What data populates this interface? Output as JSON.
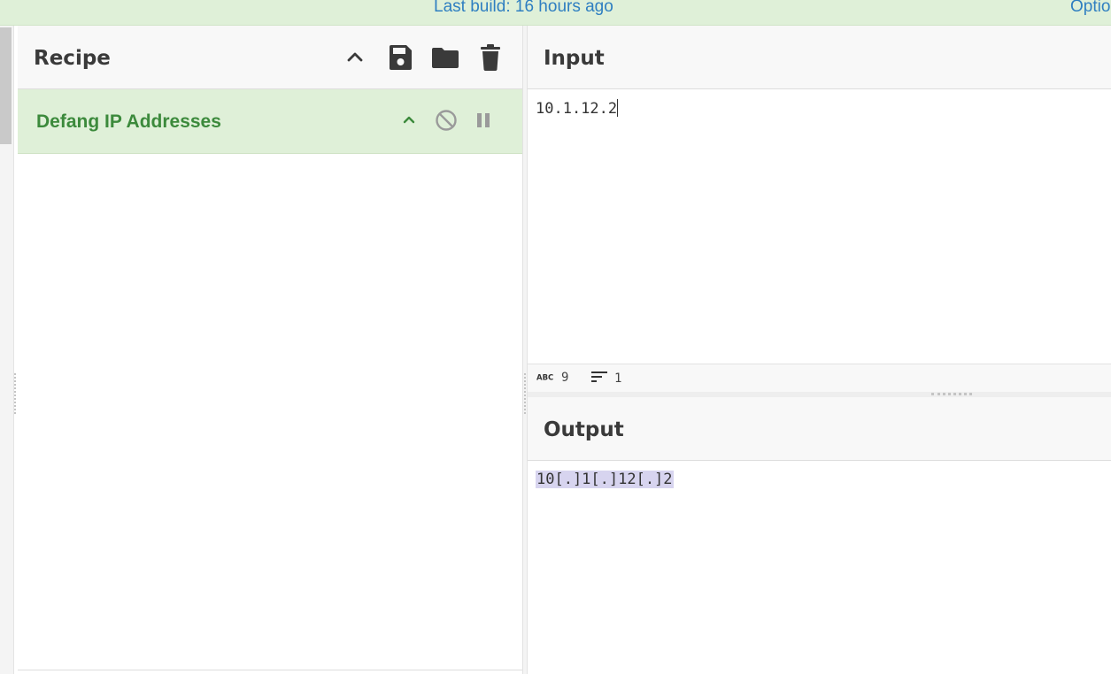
{
  "banner": {
    "build_text": "Last build: 16 hours ago",
    "options_text": "Optio"
  },
  "recipe": {
    "title": "Recipe",
    "icons": [
      "chevron-up-icon",
      "save-icon",
      "folder-icon",
      "trash-icon"
    ],
    "operations": [
      {
        "name": "Defang IP Addresses",
        "icons": [
          "chevron-up-icon",
          "disable-icon",
          "pause-icon"
        ]
      }
    ]
  },
  "input": {
    "title": "Input",
    "value": "10.1.12.2",
    "stats": {
      "chars": "9",
      "lines": "1",
      "chars_icon": "abc-icon",
      "lines_icon": "lines-icon"
    }
  },
  "output": {
    "title": "Output",
    "value": "10[.]1[.]12[.]2"
  },
  "colors": {
    "banner_bg": "#dff0d8",
    "link": "#2f7fc1",
    "operation_bg": "#dff0d8",
    "operation_text": "#3c8a3c",
    "output_highlight": "#d7d4ef"
  }
}
